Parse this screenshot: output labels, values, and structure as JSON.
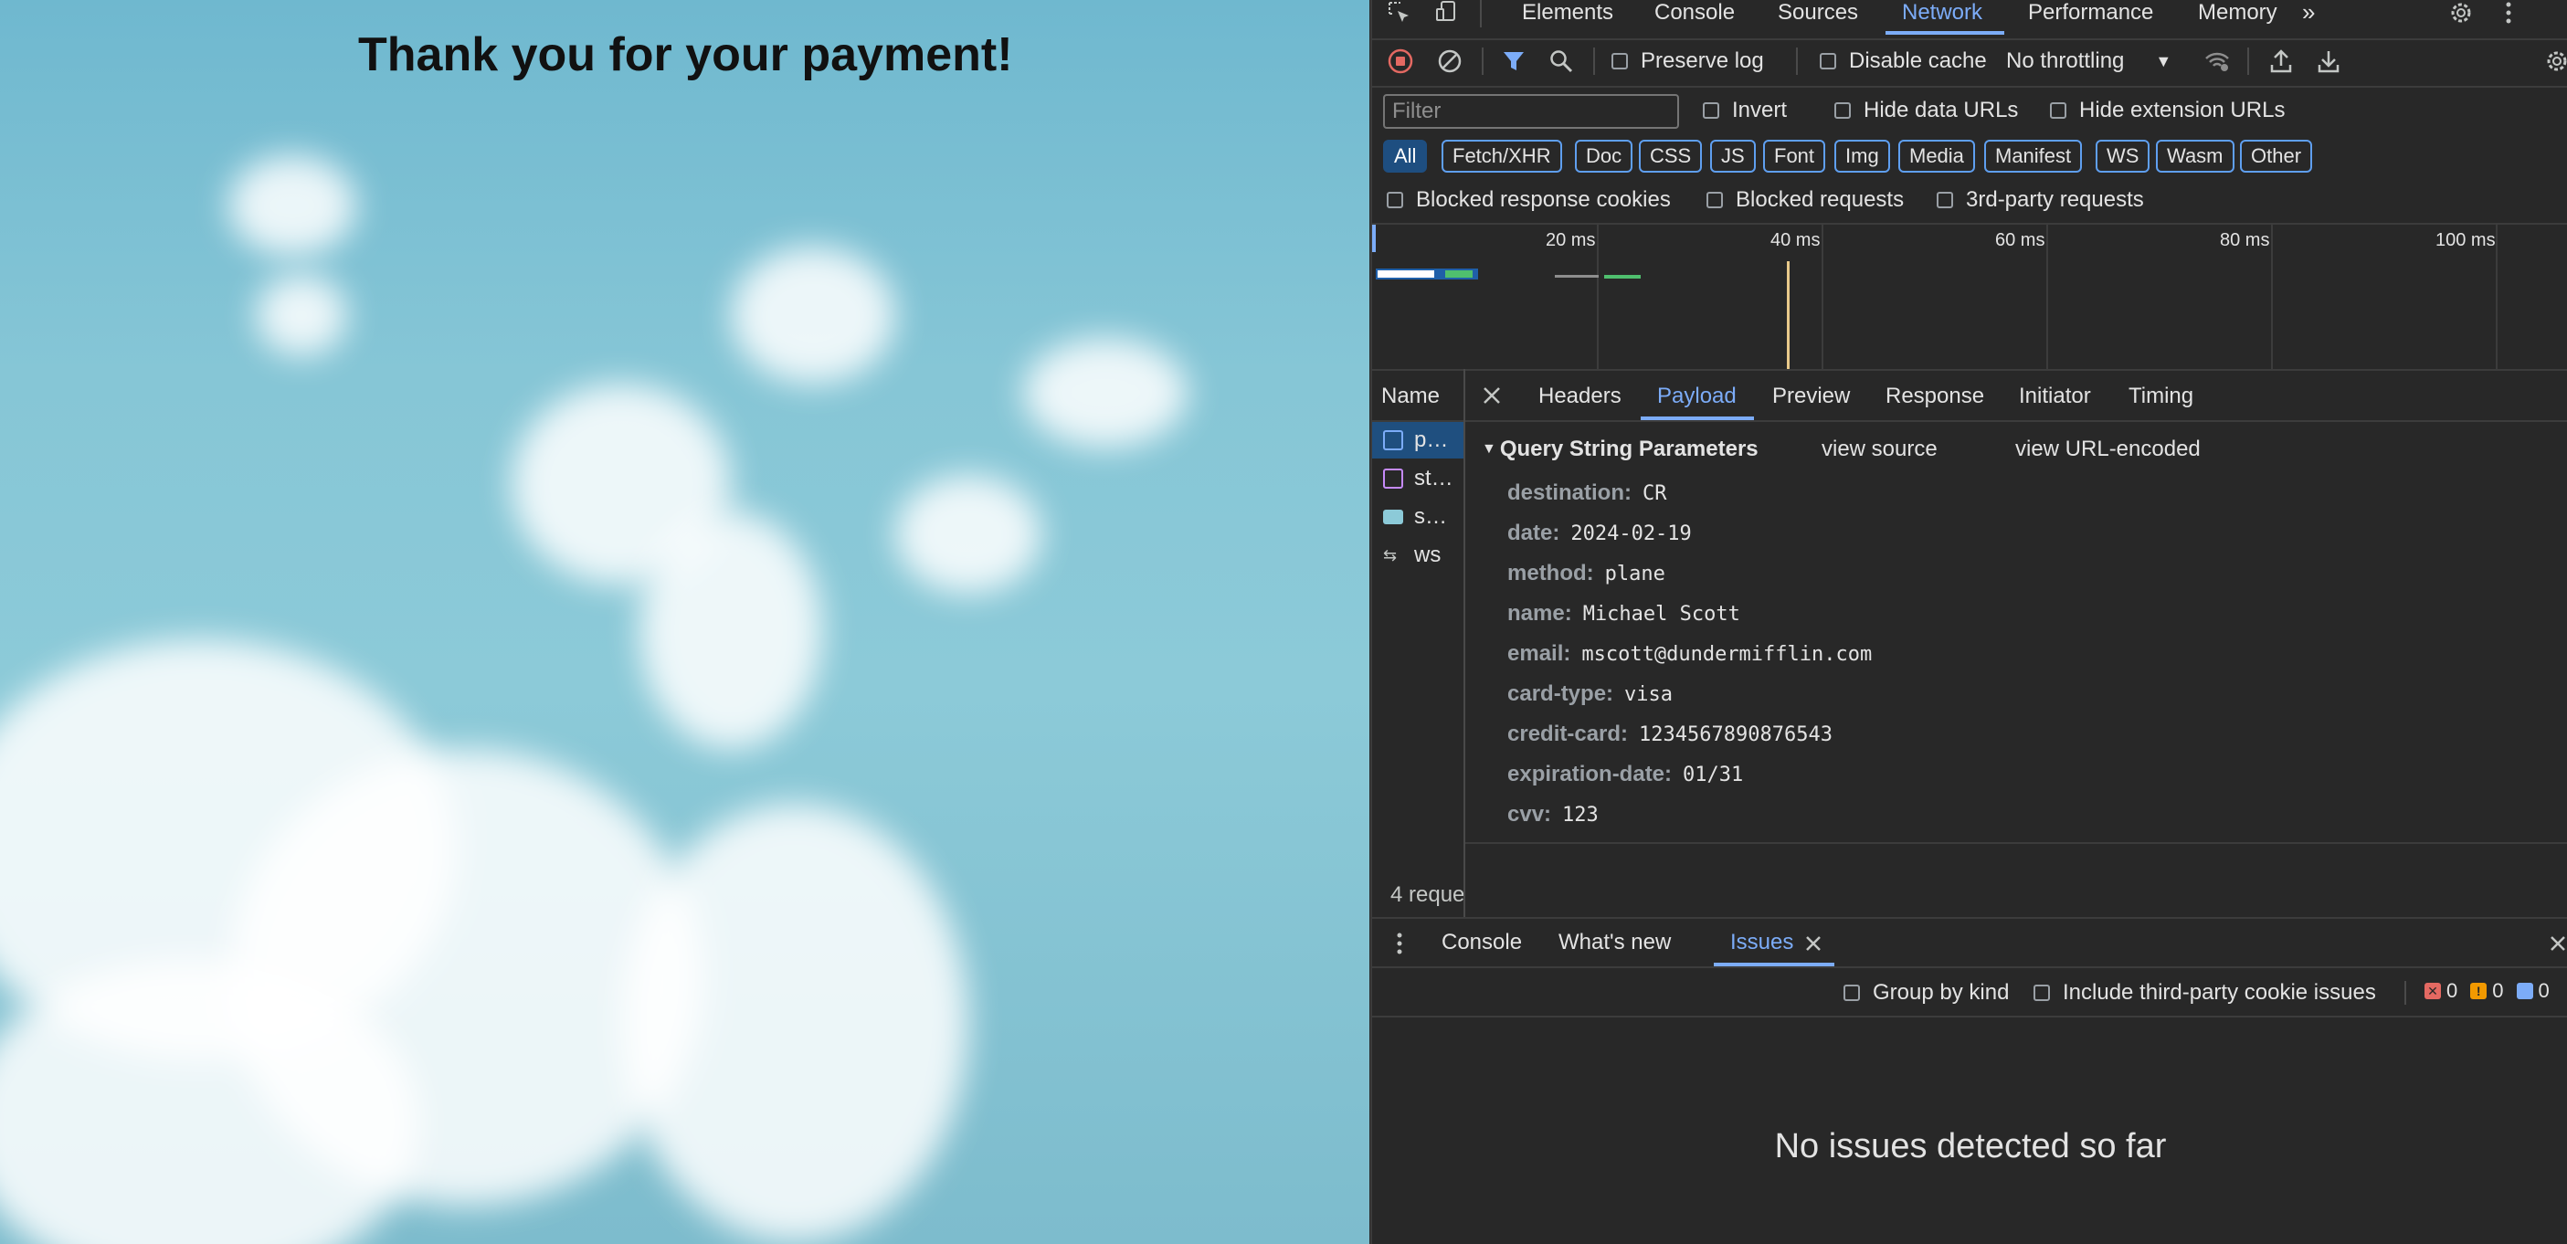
{
  "page": {
    "heading": "Thank you for your payment!"
  },
  "devtools": {
    "main_tabs": [
      "Elements",
      "Console",
      "Sources",
      "Network",
      "Performance",
      "Memory"
    ],
    "active_main_tab": "Network",
    "toolbar": {
      "preserve_log": "Preserve log",
      "disable_cache": "Disable cache",
      "throttling": "No throttling"
    },
    "filter": {
      "placeholder": "Filter",
      "invert": "Invert",
      "hide_data_urls": "Hide data URLs",
      "hide_extension_urls": "Hide extension URLs"
    },
    "type_filters": [
      "All",
      "Fetch/XHR",
      "Doc",
      "CSS",
      "JS",
      "Font",
      "Img",
      "Media",
      "Manifest",
      "WS",
      "Wasm",
      "Other"
    ],
    "selected_type_filter": "All",
    "extra_filters": {
      "blocked_cookies": "Blocked response cookies",
      "blocked_requests": "Blocked requests",
      "third_party": "3rd-party requests"
    },
    "timeline_ticks": [
      "20 ms",
      "40 ms",
      "60 ms",
      "80 ms",
      "100 ms"
    ],
    "requests": {
      "header": "Name",
      "items": [
        {
          "name": "p…",
          "icon": "document-icon",
          "selected": true
        },
        {
          "name": "st…",
          "icon": "stylesheet-icon"
        },
        {
          "name": "s…",
          "icon": "image-icon"
        },
        {
          "name": "ws",
          "icon": "websocket-icon"
        }
      ],
      "summary": "4 reque"
    },
    "detail_tabs": [
      "Headers",
      "Payload",
      "Preview",
      "Response",
      "Initiator",
      "Timing"
    ],
    "active_detail_tab": "Payload",
    "payload": {
      "section_title": "Query String Parameters",
      "view_source": "view source",
      "view_url_encoded": "view URL-encoded",
      "params": [
        {
          "key": "destination:",
          "value": "CR"
        },
        {
          "key": "date:",
          "value": "2024-02-19"
        },
        {
          "key": "method:",
          "value": "plane"
        },
        {
          "key": "name:",
          "value": "Michael Scott"
        },
        {
          "key": "email:",
          "value": "mscott@dundermifflin.com"
        },
        {
          "key": "card-type:",
          "value": "visa"
        },
        {
          "key": "credit-card:",
          "value": "1234567890876543"
        },
        {
          "key": "expiration-date:",
          "value": "01/31"
        },
        {
          "key": "cvv:",
          "value": "123"
        }
      ]
    },
    "drawer": {
      "tabs": [
        "Console",
        "What's new",
        "Issues"
      ],
      "active_tab": "Issues",
      "group_by_kind": "Group by kind",
      "include_third_party": "Include third-party cookie issues",
      "counts": {
        "errors": "0",
        "warnings": "0",
        "info": "0"
      },
      "empty_message": "No issues detected so far"
    },
    "colors": {
      "accent": "#7cacf8",
      "panel_bg": "#282828",
      "record_red": "#e46962"
    }
  }
}
